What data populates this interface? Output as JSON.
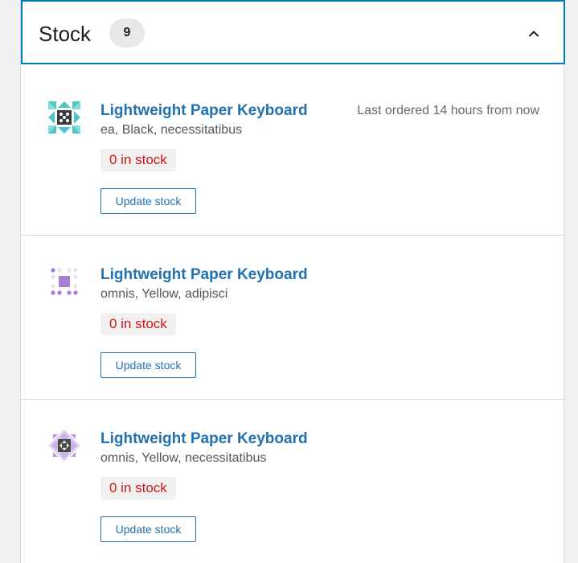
{
  "header": {
    "title": "Stock",
    "count": "9"
  },
  "items": [
    {
      "name": "Lightweight Paper Keyboard",
      "attributes": "ea, Black, necessitatibus",
      "last_ordered": "Last ordered 14 hours from now",
      "stock_status": "0 in stock",
      "update_label": "Update stock",
      "thumb_icon": "teal-geometric-pattern-icon"
    },
    {
      "name": "Lightweight Paper Keyboard",
      "attributes": "omnis, Yellow, adipisci",
      "last_ordered": "",
      "stock_status": "0 in stock",
      "update_label": "Update stock",
      "thumb_icon": "purple-dot-pattern-icon"
    },
    {
      "name": "Lightweight Paper Keyboard",
      "attributes": "omnis, Yellow, necessitatibus",
      "last_ordered": "",
      "stock_status": "0 in stock",
      "update_label": "Update stock",
      "thumb_icon": "purple-diamond-pattern-icon"
    }
  ],
  "colors": {
    "accent": "#2271b1",
    "header_border": "#007cba",
    "out_of_stock": "#cc1818"
  }
}
